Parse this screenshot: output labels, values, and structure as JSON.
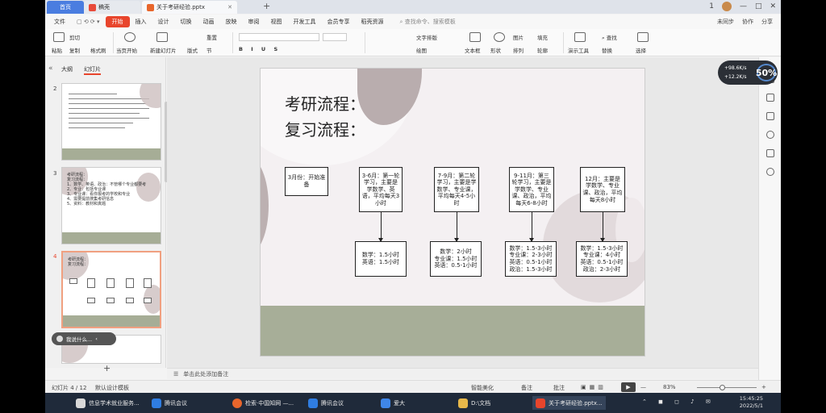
{
  "tabs": [
    {
      "label": "首页"
    },
    {
      "label": "稿壳"
    },
    {
      "label": "关于考研经验.pptx"
    }
  ],
  "titlebar": {
    "badge": "1"
  },
  "menu": {
    "items": [
      "文件",
      "开始",
      "插入",
      "设计",
      "切换",
      "动画",
      "放映",
      "审阅",
      "视图",
      "开发工具",
      "会员专享",
      "稻壳资源"
    ],
    "active": "开始",
    "search": "查找命令、搜索模板",
    "right": [
      "未同步",
      "协作",
      "分享"
    ]
  },
  "ribbon": {
    "labels": [
      "粘贴",
      "剪切",
      "复制",
      "格式刷",
      "当页开始",
      "新建幻灯片",
      "版式",
      "节",
      "重置",
      "文本框",
      "形状",
      "排列",
      "轮廓",
      "演示工具",
      "查找",
      "替换",
      "选择",
      "文字排版",
      "绘图",
      "图片",
      "填充"
    ]
  },
  "leftpanel": {
    "tabs": [
      "大纲",
      "幻灯片"
    ],
    "slide_numbers": [
      "2",
      "3",
      "4",
      "5"
    ],
    "tooltip": "我说什么...",
    "thumb3": {
      "title1": "考研流程：",
      "title2": "复习流程：",
      "lines": [
        "1、数学、英语、政治：不管哪个专业都要考",
        "2、专业：包括专业课",
        "3、专业课：看你报考的学校和专业",
        "4、需要提前搜集考研信息",
        "5、资料：教材和真题"
      ]
    },
    "thumb4": {
      "title1": "考研流程：",
      "title2": "复习流程："
    }
  },
  "slide": {
    "title1": "考研流程：",
    "title2": "复习流程：",
    "top_boxes": [
      "3月份：开始准备",
      "3-6月：第一轮学习，主要是学数学、英语，平均每天3小时",
      "7-9月：第二轮学习，主要是学数学、专业课，平均每天4-5小时",
      "9-11月：第三轮学习，主要是学数学、专业课、政治，平均每天6-8小时",
      "12月：主要是学数学、专业课、政治，平均每天8小时"
    ],
    "bottom_boxes": [
      [
        "数学：1.5小时",
        "英语：1.5小时"
      ],
      [
        "数学：2小时",
        "专业课：1.5小时",
        "英语：0.5-1小时"
      ],
      [
        "数学：1.5-3小时",
        "专业课：2-3小时",
        "英语：0.5-1小时",
        "政治：1.5-3小时"
      ],
      [
        "数学：1.5-3小时",
        "专业课：4小时",
        "英语：0.5-1小时",
        "政治：2-3小时"
      ]
    ]
  },
  "notes": {
    "placeholder": "单击此处添加备注"
  },
  "speed": {
    "up": "+98.6K/s",
    "down": "+12.2K/s",
    "percent": "50%"
  },
  "status": {
    "slide": "幻灯片 4 / 12",
    "theme": "默认设计模板",
    "beautify": "智能美化",
    "notes_btn": "备注",
    "comments_btn": "批注",
    "zoom": "83%"
  },
  "taskbar": {
    "items": [
      "信息学术就业服务...",
      "腾讯会议",
      "检索·中国知网 —...",
      "腾讯会议",
      "爱大",
      "D:\\文档",
      "关于考研经验.pptx..."
    ],
    "time": "15:45:25",
    "date": "2022/5/1"
  },
  "colors": {
    "accent": "#e8452c",
    "band": "#a7ae98",
    "blob": "#b5a9aa",
    "taskbar": "#1f2a3a"
  }
}
